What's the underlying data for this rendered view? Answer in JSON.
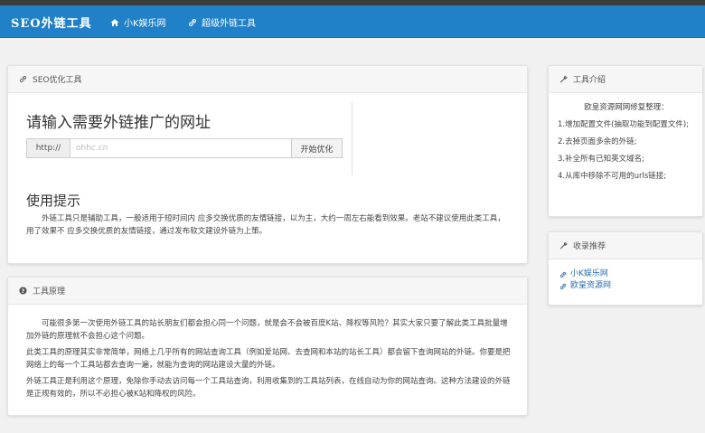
{
  "navbar": {
    "brand": "SEO外链工具",
    "items": [
      {
        "label": "小K娱乐网",
        "icon": "home-icon"
      },
      {
        "label": "超级外链工具",
        "icon": "link-icon"
      }
    ]
  },
  "seo_panel": {
    "header": "SEO优化工具",
    "heading": "请输入需要外链推广的网址",
    "input_prefix": "http://",
    "input_placeholder": "ohhc.cn",
    "submit_label": "开始优化",
    "tips_heading": "使用提示",
    "tips_text": "外链工具只是辅助工具，一般适用于短时间内 应多交换优质的友情链接，以为主，大约一周左右能看到效果。老站不建议使用此类工具，用了效果不 应多交换优质的友情链接，通过发布软文建设外链为上策。"
  },
  "principle_panel": {
    "header": "工具原理",
    "paragraphs": [
      "可能很多第一次使用外链工具的站长朋友们都会担心同一个问题，就是会不会被百度K站、降权等风险？其实大家只要了解此类工具批量增加外链的原理就不会担心这个问题。",
      "此类工具的原理其实非常简单，网络上几乎所有的网站查询工具（例如爱站网、去查网和本站的站长工具）都会留下查询网站的外链。你要是把网络上的每一个工具站都去查询一遍，就能为查询的网站建设大量的外链。",
      "外链工具正是利用这个原理，免除你手动去访问每一个工具站查询，利用收集到的工具站列表，在线自动为你的网站查询。这种方法建设的外链是正规有效的，所以不必担心被K站和降权的风险。"
    ]
  },
  "intro_panel": {
    "header": "工具介绍",
    "title": "欧皇资源网网修复整理：",
    "items": [
      "1.增加配置文件(抽取功能到配置文件);",
      "2.去掉页面多余的外链;",
      "3.补全所有已知英文域名;",
      "4.从库中移除不可用的urls链接;"
    ]
  },
  "recommend_panel": {
    "header": "收录推荐",
    "links": [
      "小K娱乐网",
      "欧皇资源网"
    ]
  }
}
